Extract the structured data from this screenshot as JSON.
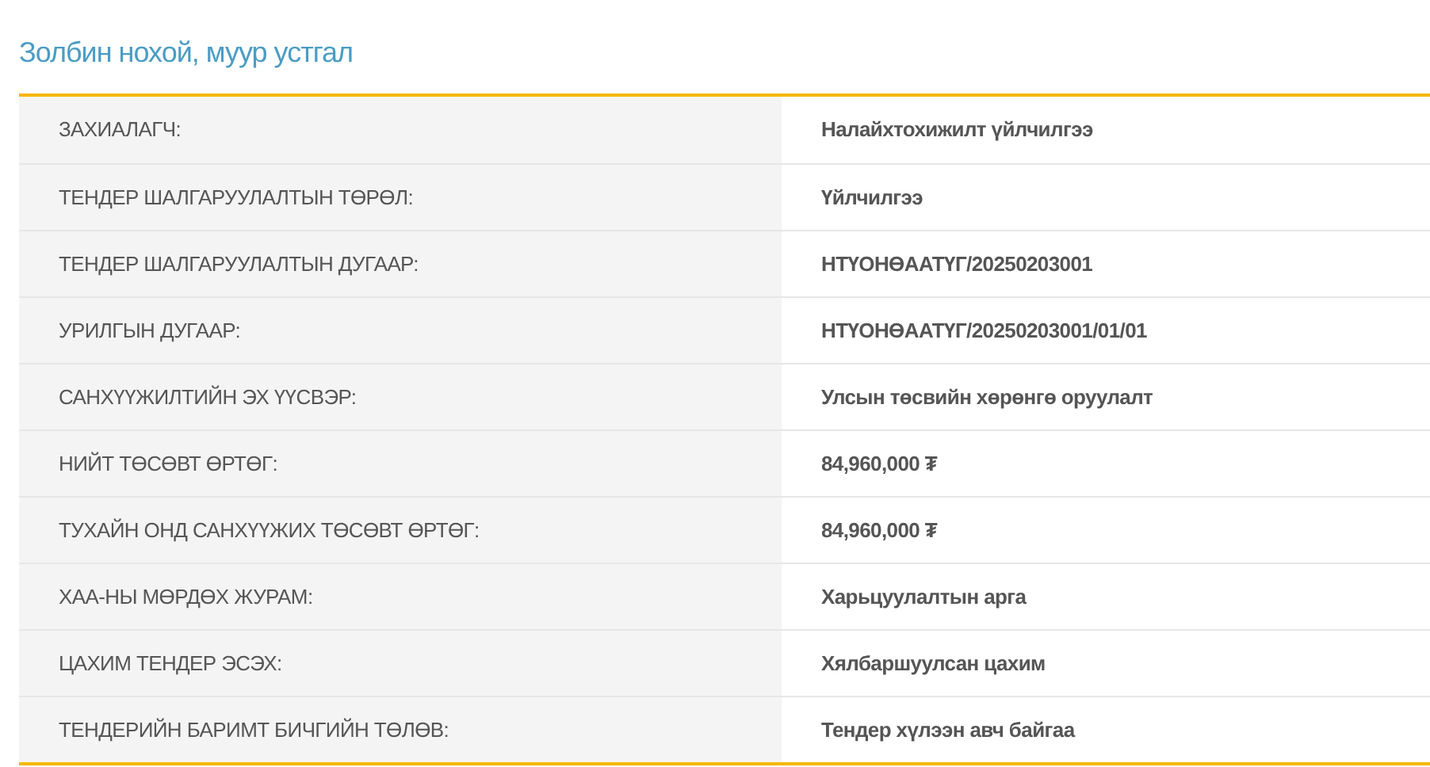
{
  "title": "Золбин нохой, муур устгал",
  "rows": [
    {
      "label": "ЗАХИАЛАГЧ:",
      "value": "Налайхтохижилт үйлчилгээ"
    },
    {
      "label": "ТЕНДЕР ШАЛГАРУУЛАЛТЫН ТӨРӨЛ:",
      "value": "Үйлчилгээ"
    },
    {
      "label": "ТЕНДЕР ШАЛГАРУУЛАЛТЫН ДУГААР:",
      "value": "НТҮОНӨААТҮГ/20250203001"
    },
    {
      "label": "УРИЛГЫН ДУГААР:",
      "value": "НТҮОНӨААТҮГ/20250203001/01/01"
    },
    {
      "label": "САНХҮҮЖИЛТИЙН ЭХ ҮҮСВЭР:",
      "value": "Улсын төсвийн хөрөнгө оруулалт"
    },
    {
      "label": "НИЙТ ТӨСӨВТ ӨРТӨГ:",
      "value": "84,960,000 ₮"
    },
    {
      "label": "ТУХАЙН ОНД САНХҮҮЖИХ ТӨСӨВТ ӨРТӨГ:",
      "value": "84,960,000 ₮"
    },
    {
      "label": "ХАА-НЫ МӨРДӨХ ЖУРАМ:",
      "value": "Харьцуулалтын арга"
    },
    {
      "label": "ЦАХИМ ТЕНДЕР ЭСЭХ:",
      "value": "Хялбаршуулсан цахим"
    },
    {
      "label": "ТЕНДЕРИЙН БАРИМТ БИЧГИЙН ТӨЛӨВ:",
      "value": "Тендер хүлээн авч байгаа"
    }
  ]
}
